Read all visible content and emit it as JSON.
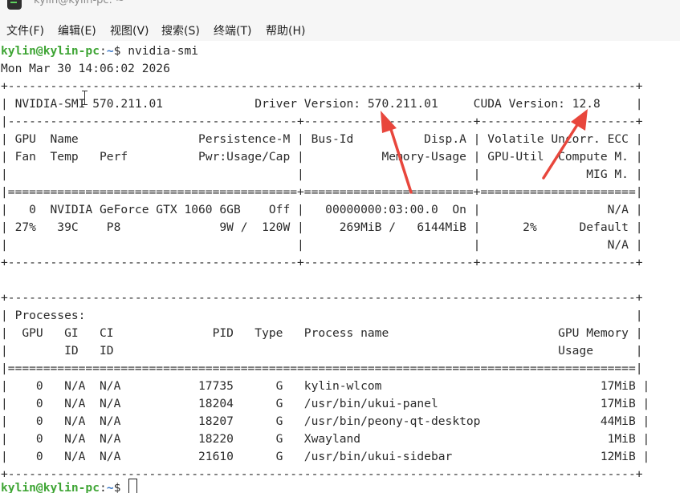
{
  "window": {
    "title": "kylin@kylin-pc: ~"
  },
  "menu": {
    "file": "文件(F)",
    "edit": "编辑(E)",
    "view": "视图(V)",
    "search": "搜索(S)",
    "terminal": "终端(T)",
    "help": "帮助(H)"
  },
  "terminal": {
    "prompt_user": "kylin@kylin-pc",
    "prompt_path": "~",
    "prompt_symbol": "$",
    "command": " nvidia-smi",
    "lines": [
      "Mon Mar 30 14:06:02 2026",
      "+-----------------------------------------------------------------------------------------+",
      "| NVIDIA-SMI 570.211.01             Driver Version: 570.211.01     CUDA Version: 12.8     |",
      "|-----------------------------------------+------------------------+----------------------+",
      "| GPU  Name                 Persistence-M | Bus-Id          Disp.A | Volatile Uncorr. ECC |",
      "| Fan  Temp   Perf          Pwr:Usage/Cap |           Memory-Usage | GPU-Util  Compute M. |",
      "|                                         |                        |               MIG M. |",
      "|=========================================+========================+======================|",
      "|   0  NVIDIA GeForce GTX 1060 6GB    Off |   00000000:03:00.0  On |                  N/A |",
      "| 27%   39C    P8              9W /  120W |     269MiB /   6144MiB |      2%      Default |",
      "|                                         |                        |                  N/A |",
      "+-----------------------------------------+------------------------+----------------------+",
      "",
      "+-----------------------------------------------------------------------------------------+",
      "| Processes:                                                                              |",
      "|  GPU   GI   CI              PID   Type   Process name                        GPU Memory |",
      "|        ID   ID                                                               Usage      |",
      "|=========================================================================================|",
      "|    0   N/A  N/A           17735      G   kylin-wlcom                               17MiB |",
      "|    0   N/A  N/A           18204      G   /usr/bin/ukui-panel                       17MiB |",
      "|    0   N/A  N/A           18207      G   /usr/bin/peony-qt-desktop                 44MiB |",
      "|    0   N/A  N/A           18220      G   Xwayland                                   1MiB |",
      "|    0   N/A  N/A           21610      G   /usr/bin/ukui-sidebar                     12MiB |",
      "+-----------------------------------------------------------------------------------------+"
    ],
    "final_prompt_user": "kylin@kylin-pc",
    "final_prompt_path": "~",
    "final_prompt_symbol": "$ "
  },
  "colors": {
    "prompt_user": "#3fa535",
    "prompt_path": "#3b78c6",
    "annotation_arrow": "#e8463c"
  },
  "icons": {
    "app": "terminal-app-icon",
    "pointer": "text-cursor-ibeam-icon"
  }
}
